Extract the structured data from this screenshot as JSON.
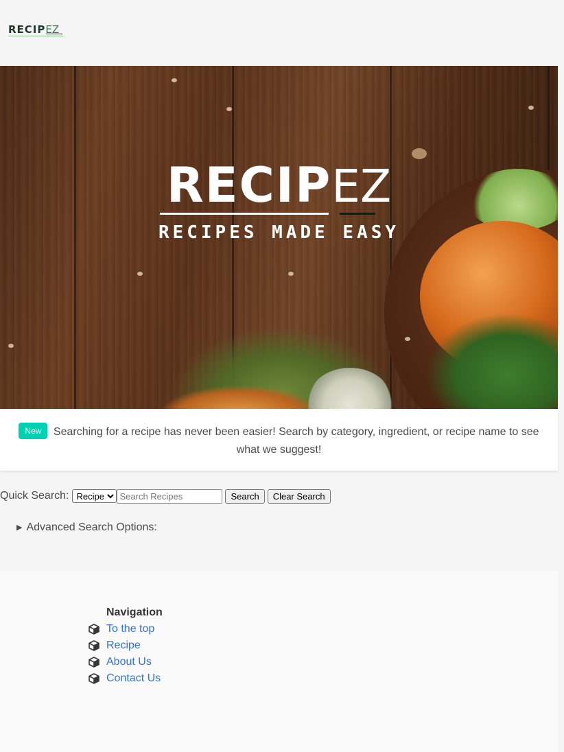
{
  "header": {
    "logo_main": "RECIP",
    "logo_ez": "EZ"
  },
  "hero": {
    "title_main": "RECIP",
    "title_ez": "EZ",
    "subtitle": "RECIPES MADE EASY"
  },
  "notice": {
    "tag": "New",
    "text": "Searching for a recipe has never been easier! Search by category, ingredient, or recipe name to see what we suggest!"
  },
  "search": {
    "label": "Quick Search:",
    "select_value": "Recipe",
    "placeholder": "Search Recipes",
    "search_button": "Search",
    "clear_button": "Clear Search"
  },
  "advanced": {
    "label": "Advanced Search Options:"
  },
  "footer": {
    "nav_title": "Navigation",
    "items": [
      {
        "label": "To the top",
        "icon": "cube-icon"
      },
      {
        "label": "Recipe",
        "icon": "cube-icon"
      },
      {
        "label": "About Us",
        "icon": "cube-icon"
      },
      {
        "label": "Contact Us",
        "icon": "cube-icon"
      }
    ]
  },
  "colors": {
    "accent_tag": "#00d1b2",
    "link": "#3273dc",
    "logo_dark": "#1f3a2b"
  }
}
